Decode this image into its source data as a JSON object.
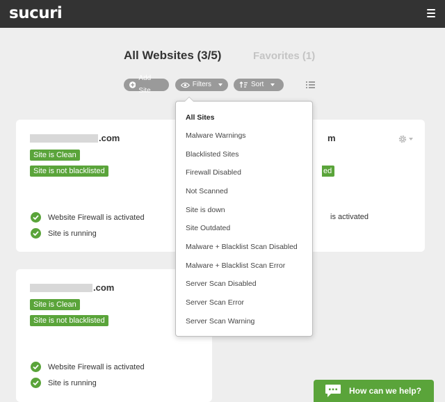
{
  "header": {
    "logo": "sucuri"
  },
  "heading": {
    "all_websites": "All Websites (3/5)",
    "favorites": "Favorites (1)"
  },
  "toolbar": {
    "add_site": "Add Site",
    "filters": "Filters",
    "sort": "Sort"
  },
  "filters_menu": {
    "items": [
      "All Sites",
      "Malware Warnings",
      "Blacklisted Sites",
      "Firewall Disabled",
      "Not Scanned",
      "Site is down",
      "Site Outdated",
      "Malware + Blacklist Scan Disabled",
      "Malware + Blacklist Scan Error",
      "Server Scan Disabled",
      "Server Scan Error",
      "Server Scan Warning"
    ],
    "active_index": 0
  },
  "cards": [
    {
      "domain_suffix": ".com",
      "badges": [
        "Site is Clean",
        "Site is not blacklisted"
      ],
      "statuses": [
        "Website Firewall is activated",
        "Site is running"
      ]
    },
    {
      "domain_suffix": ".com",
      "badges": [
        "Site is Clean",
        "Site is not blacklisted"
      ],
      "statuses": [
        "Website Firewall is activated",
        "Site is running"
      ]
    }
  ],
  "card1_partial": {
    "domain_fragment": "m",
    "badge_fragment": "ed",
    "status_fragment": "is activated"
  },
  "help": {
    "label": "How can we help?"
  },
  "colors": {
    "topbar": "#333333",
    "accent_green": "#5aa43a",
    "pill_gray": "#9a9a9a",
    "background": "#eeeeee"
  }
}
